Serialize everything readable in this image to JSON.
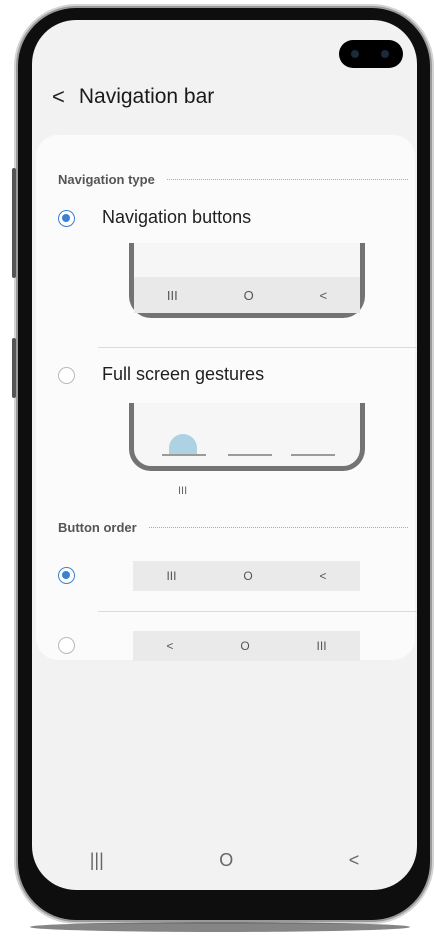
{
  "header": {
    "back_icon": "<",
    "title": "Navigation bar"
  },
  "navigation_type": {
    "section_label": "Navigation type",
    "options": [
      {
        "label": "Navigation buttons",
        "selected": true
      },
      {
        "label": "Full screen gestures",
        "selected": false
      }
    ],
    "buttons_preview": [
      "III",
      "O",
      "<"
    ],
    "gesture_hint": "III"
  },
  "button_order": {
    "section_label": "Button order",
    "options": [
      {
        "icons": [
          "III",
          "O",
          "<"
        ],
        "selected": true
      },
      {
        "icons": [
          "<",
          "O",
          "III"
        ],
        "selected": false
      }
    ]
  },
  "nav_bar": [
    "|||",
    "O",
    "<"
  ],
  "colors": {
    "accent": "#3d7fd1",
    "background": "#f2f2f2",
    "card": "#fbfbfb"
  }
}
